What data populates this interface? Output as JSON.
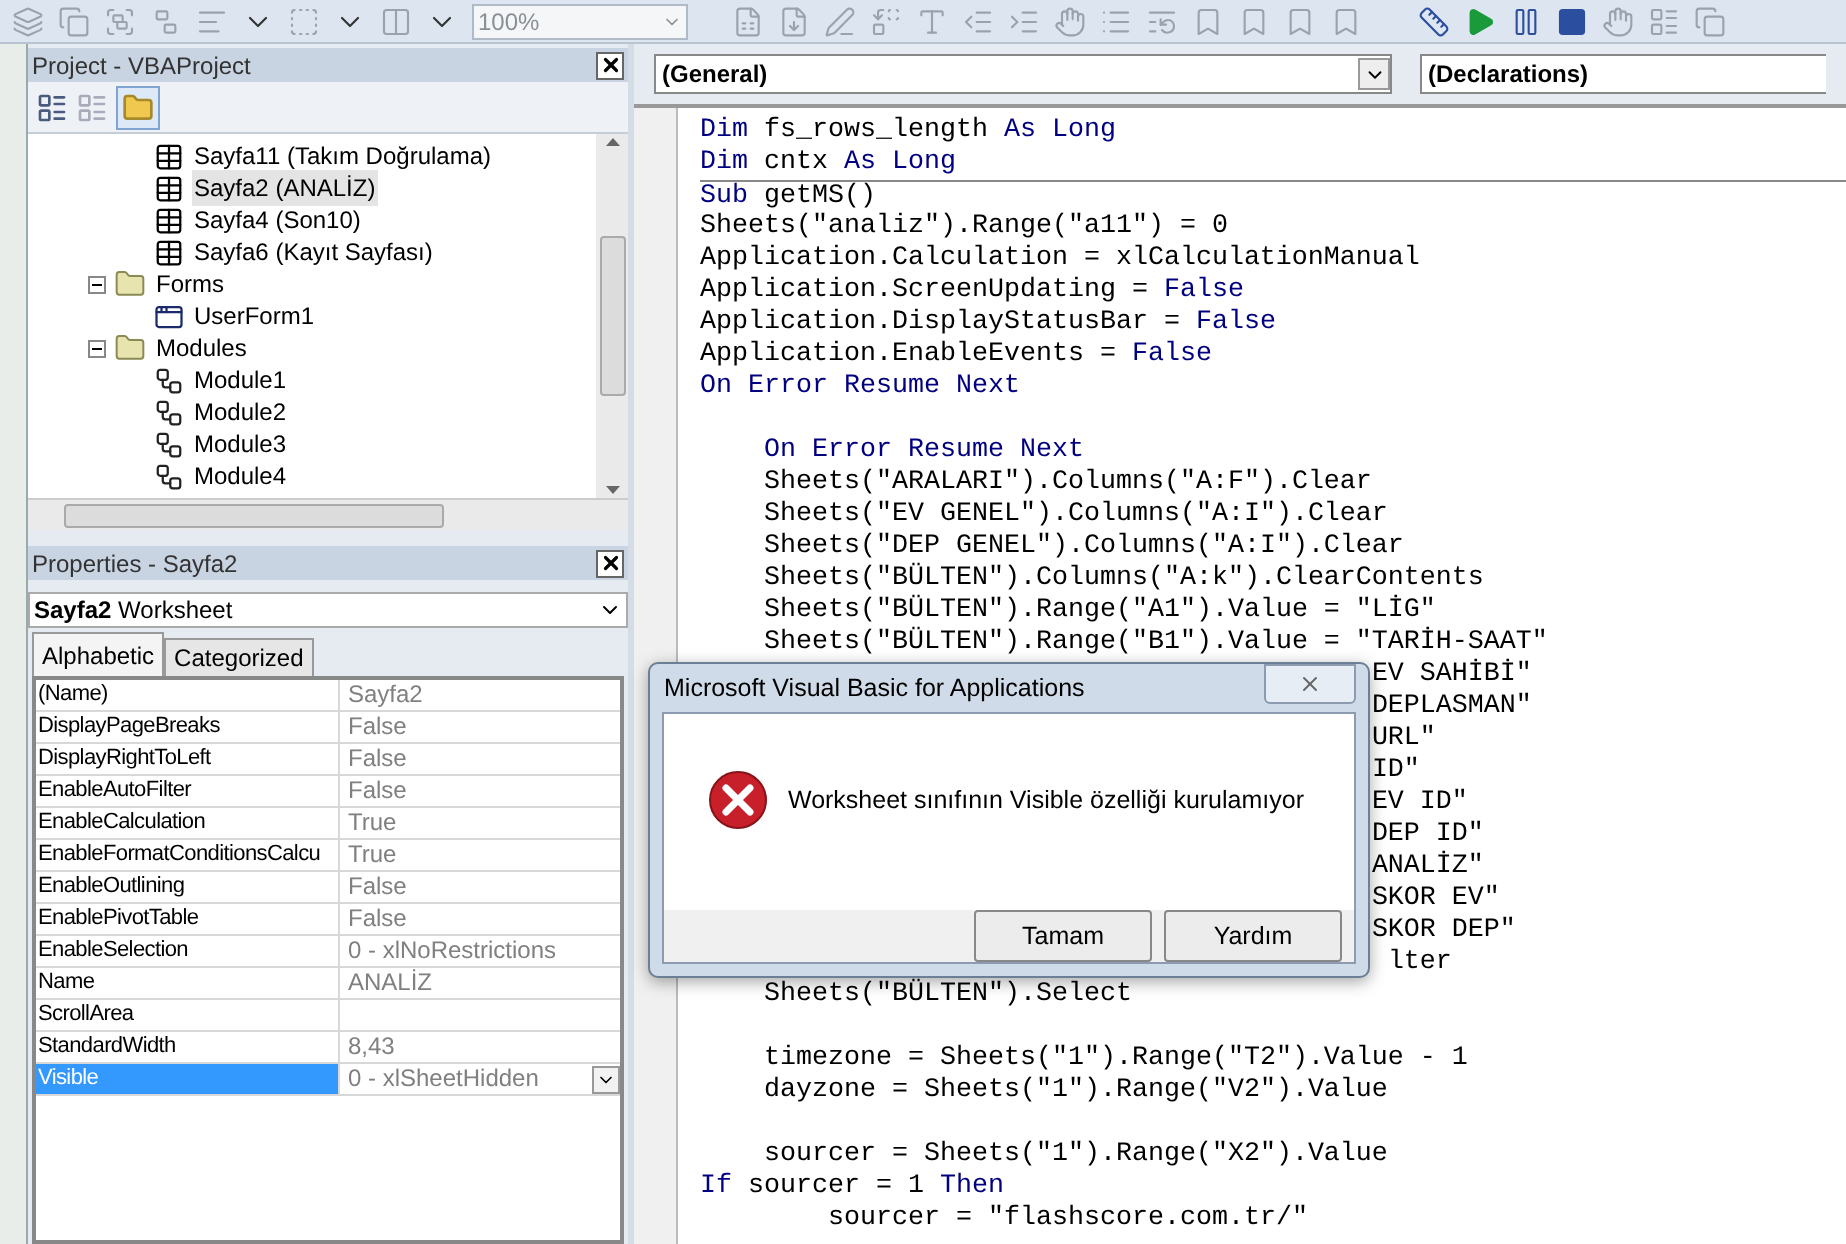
{
  "toolbar": {
    "zoom": "100%"
  },
  "project": {
    "title": "Project - VBAProject",
    "tree": [
      {
        "children": [
          {
            "kind": "sheet",
            "label": "Sayfa11 (Takım Doğrulama)",
            "selected": false
          },
          {
            "kind": "sheet",
            "label": "Sayfa2 (ANALİZ)",
            "selected": true
          },
          {
            "kind": "sheet",
            "label": "Sayfa4 (Son10)",
            "selected": false
          },
          {
            "kind": "sheet",
            "label": "Sayfa6 (Kayıt Sayfası)",
            "selected": false
          }
        ]
      },
      {
        "kind": "folder",
        "label": "Forms",
        "expanded": true,
        "selected": false,
        "children": [
          {
            "kind": "form",
            "label": "UserForm1",
            "selected": false
          }
        ]
      },
      {
        "kind": "folder",
        "label": "Modules",
        "expanded": true,
        "selected": false,
        "children": [
          {
            "kind": "module",
            "label": "Module1",
            "selected": false
          },
          {
            "kind": "module",
            "label": "Module2",
            "selected": false
          },
          {
            "kind": "module",
            "label": "Module3",
            "selected": false
          },
          {
            "kind": "module",
            "label": "Module4",
            "selected": false
          }
        ]
      }
    ]
  },
  "properties": {
    "title": "Properties - Sayfa2",
    "object_name": "Sayfa2",
    "object_type": "Worksheet",
    "tabs": [
      {
        "label": "Alphabetic",
        "selected": true
      },
      {
        "label": "Categorized",
        "selected": false
      }
    ],
    "rows": [
      {
        "name": "(Name)",
        "value": "Sayfa2",
        "selected": false
      },
      {
        "name": "DisplayPageBreaks",
        "value": "False",
        "selected": false
      },
      {
        "name": "DisplayRightToLeft",
        "value": "False",
        "selected": false
      },
      {
        "name": "EnableAutoFilter",
        "value": "False",
        "selected": false
      },
      {
        "name": "EnableCalculation",
        "value": "True",
        "selected": false
      },
      {
        "name": "EnableFormatConditionsCalcu",
        "value": "True",
        "selected": false
      },
      {
        "name": "EnableOutlining",
        "value": "False",
        "selected": false
      },
      {
        "name": "EnablePivotTable",
        "value": "False",
        "selected": false
      },
      {
        "name": "EnableSelection",
        "value": "0 - xlNoRestrictions",
        "selected": false
      },
      {
        "name": "Name",
        "value": "ANALİZ",
        "selected": false
      },
      {
        "name": "ScrollArea",
        "selected": false
      },
      {
        "name": "StandardWidth",
        "value": "8,43",
        "selected": false
      },
      {
        "name": "Visible",
        "value": "0 - xlSheetHidden",
        "selected": true
      }
    ]
  },
  "code": {
    "object_combo": "(General)",
    "procedure_combo": "(Declarations)",
    "lines": [
      {
        "kind": "code",
        "segments": [
          {
            "kind": "keyword",
            "text": "Dim"
          },
          {
            "kind": "plain",
            "text": " fs_rows_length "
          },
          {
            "kind": "keyword",
            "text": "As Long"
          }
        ]
      },
      {
        "kind": "code",
        "segments": [
          {
            "kind": "keyword",
            "text": "Dim"
          },
          {
            "kind": "plain",
            "text": " cntx "
          },
          {
            "kind": "keyword",
            "text": "As Long"
          }
        ]
      },
      {
        "kind": "code",
        "procedure_start": true,
        "segments": [
          {
            "kind": "keyword",
            "text": "Sub"
          },
          {
            "kind": "plain",
            "text": " getMS()"
          }
        ]
      },
      {
        "kind": "code",
        "segments": [
          {
            "kind": "plain",
            "text": "Sheets(\"analiz\").Range(\"a11\") = 0"
          }
        ]
      },
      {
        "kind": "code",
        "segments": [
          {
            "kind": "plain",
            "text": "Application.Calculation = xlCalculationManual"
          }
        ]
      },
      {
        "kind": "code",
        "segments": [
          {
            "kind": "plain",
            "text": "Application.ScreenUpdating = "
          },
          {
            "kind": "keyword",
            "text": "False"
          }
        ]
      },
      {
        "kind": "code",
        "segments": [
          {
            "kind": "plain",
            "text": "Application.DisplayStatusBar = "
          },
          {
            "kind": "keyword",
            "text": "False"
          }
        ]
      },
      {
        "kind": "code",
        "segments": [
          {
            "kind": "plain",
            "text": "Application.EnableEvents = "
          },
          {
            "kind": "keyword",
            "text": "False"
          }
        ]
      },
      {
        "kind": "code",
        "segments": [
          {
            "kind": "keyword",
            "text": "On Error Resume Next"
          }
        ]
      },
      {
        "kind": "blank"
      },
      {
        "kind": "code",
        "segments": [
          {
            "kind": "keyword",
            "text": "    On Error Resume Next"
          }
        ]
      },
      {
        "kind": "code",
        "segments": [
          {
            "kind": "plain",
            "text": "    Sheets(\"ARALARI\").Columns(\"A:F\").Clear"
          }
        ]
      },
      {
        "kind": "code",
        "segments": [
          {
            "kind": "plain",
            "text": "    Sheets(\"EV GENEL\").Columns(\"A:I\").Clear"
          }
        ]
      },
      {
        "kind": "code",
        "segments": [
          {
            "kind": "plain",
            "text": "    Sheets(\"DEP GENEL\").Columns(\"A:I\").Clear"
          }
        ]
      },
      {
        "kind": "code",
        "segments": [
          {
            "kind": "plain",
            "text": "    Sheets(\"BÜLTEN\").Columns(\"A:k\").ClearContents"
          }
        ]
      },
      {
        "kind": "code",
        "segments": [
          {
            "kind": "plain",
            "text": "    Sheets(\"BÜLTEN\").Range(\"A1\").Value = \"LİG\""
          }
        ]
      },
      {
        "kind": "code",
        "segments": [
          {
            "kind": "plain",
            "text": "    Sheets(\"BÜLTEN\").Range(\"B1\").Value = \"TARİH-SAAT\""
          }
        ]
      },
      {
        "kind": "code",
        "segments": [
          {
            "kind": "plain",
            "text": "                                          EV SAHİBİ\""
          }
        ]
      },
      {
        "kind": "code",
        "segments": [
          {
            "kind": "plain",
            "text": "                                          DEPLASMAN\""
          }
        ]
      },
      {
        "kind": "code",
        "segments": [
          {
            "kind": "plain",
            "text": "                                          URL\""
          }
        ]
      },
      {
        "kind": "code",
        "segments": [
          {
            "kind": "plain",
            "text": "                                          ID\""
          }
        ]
      },
      {
        "kind": "code",
        "segments": [
          {
            "kind": "plain",
            "text": "                                          EV ID\""
          }
        ]
      },
      {
        "kind": "code",
        "segments": [
          {
            "kind": "plain",
            "text": "                                          DEP ID\""
          }
        ]
      },
      {
        "kind": "code",
        "segments": [
          {
            "kind": "plain",
            "text": "                                          ANALİZ\""
          }
        ]
      },
      {
        "kind": "code",
        "segments": [
          {
            "kind": "plain",
            "text": "                                          SKOR EV\""
          }
        ]
      },
      {
        "kind": "code",
        "segments": [
          {
            "kind": "plain",
            "text": "                                          SKOR DEP\""
          }
        ]
      },
      {
        "kind": "code",
        "segments": [
          {
            "kind": "plain",
            "text": "                                           lter"
          }
        ]
      },
      {
        "kind": "code",
        "segments": [
          {
            "kind": "plain",
            "text": "    Sheets(\"BÜLTEN\").Select"
          }
        ]
      },
      {
        "kind": "blank"
      },
      {
        "kind": "code",
        "segments": [
          {
            "kind": "plain",
            "text": "    timezone = Sheets(\"1\").Range(\"T2\").Value - 1"
          }
        ]
      },
      {
        "kind": "code",
        "segments": [
          {
            "kind": "plain",
            "text": "    dayzone = Sheets(\"1\").Range(\"V2\").Value"
          }
        ]
      },
      {
        "kind": "blank"
      },
      {
        "kind": "code",
        "segments": [
          {
            "kind": "plain",
            "text": "    sourcer = Sheets(\"1\").Range(\"X2\").Value"
          }
        ]
      },
      {
        "kind": "code",
        "segments": [
          {
            "kind": "keyword",
            "text": "If"
          },
          {
            "kind": "plain",
            "text": " sourcer = 1 "
          },
          {
            "kind": "keyword",
            "text": "Then"
          }
        ]
      },
      {
        "kind": "code",
        "segments": [
          {
            "kind": "plain",
            "text": "        sourcer = \"flashscore.com.tr/\""
          }
        ]
      }
    ]
  },
  "dialog": {
    "title": "Microsoft Visual Basic for Applications",
    "kind": "error",
    "message": "Worksheet sınıfının Visible özelliği kurulamıyor",
    "buttons": [
      "Tamam",
      "Yardım"
    ]
  }
}
